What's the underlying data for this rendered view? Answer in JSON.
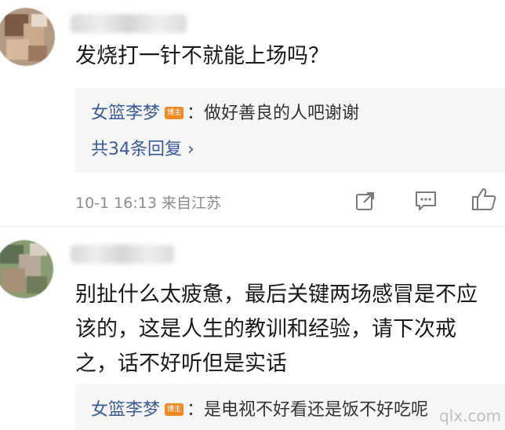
{
  "comments": [
    {
      "text_lines": [
        "发烧打一针不就能上场吗？"
      ],
      "reply_preview": {
        "user": "女篮李梦",
        "badge": "博主",
        "text": "：做好善良的人吧谢谢",
        "count_label": "共34条回复 ›"
      },
      "meta": "10-1 16:13  来自江苏"
    },
    {
      "text_lines": [
        "别扯什么太疲惫，最后关键两场感冒是不应",
        "该的，这是人生的教训和经验，请下次戒",
        "之，话不好听但是实话"
      ],
      "reply_preview": {
        "user": "女篮李梦",
        "badge": "博主",
        "text": "：是电视不好看还是饭不好吃呢"
      }
    }
  ],
  "actions": {
    "share_icon": "share-icon",
    "comment_icon": "comment-icon",
    "like_icon": "thumbs-up-icon"
  },
  "watermark": "qlx.com",
  "colors": {
    "link_blue": "#3b5b9a",
    "badge_orange": "#f08a24",
    "reply_bg": "#f6f6f6",
    "meta_gray": "#8c8c8c"
  }
}
